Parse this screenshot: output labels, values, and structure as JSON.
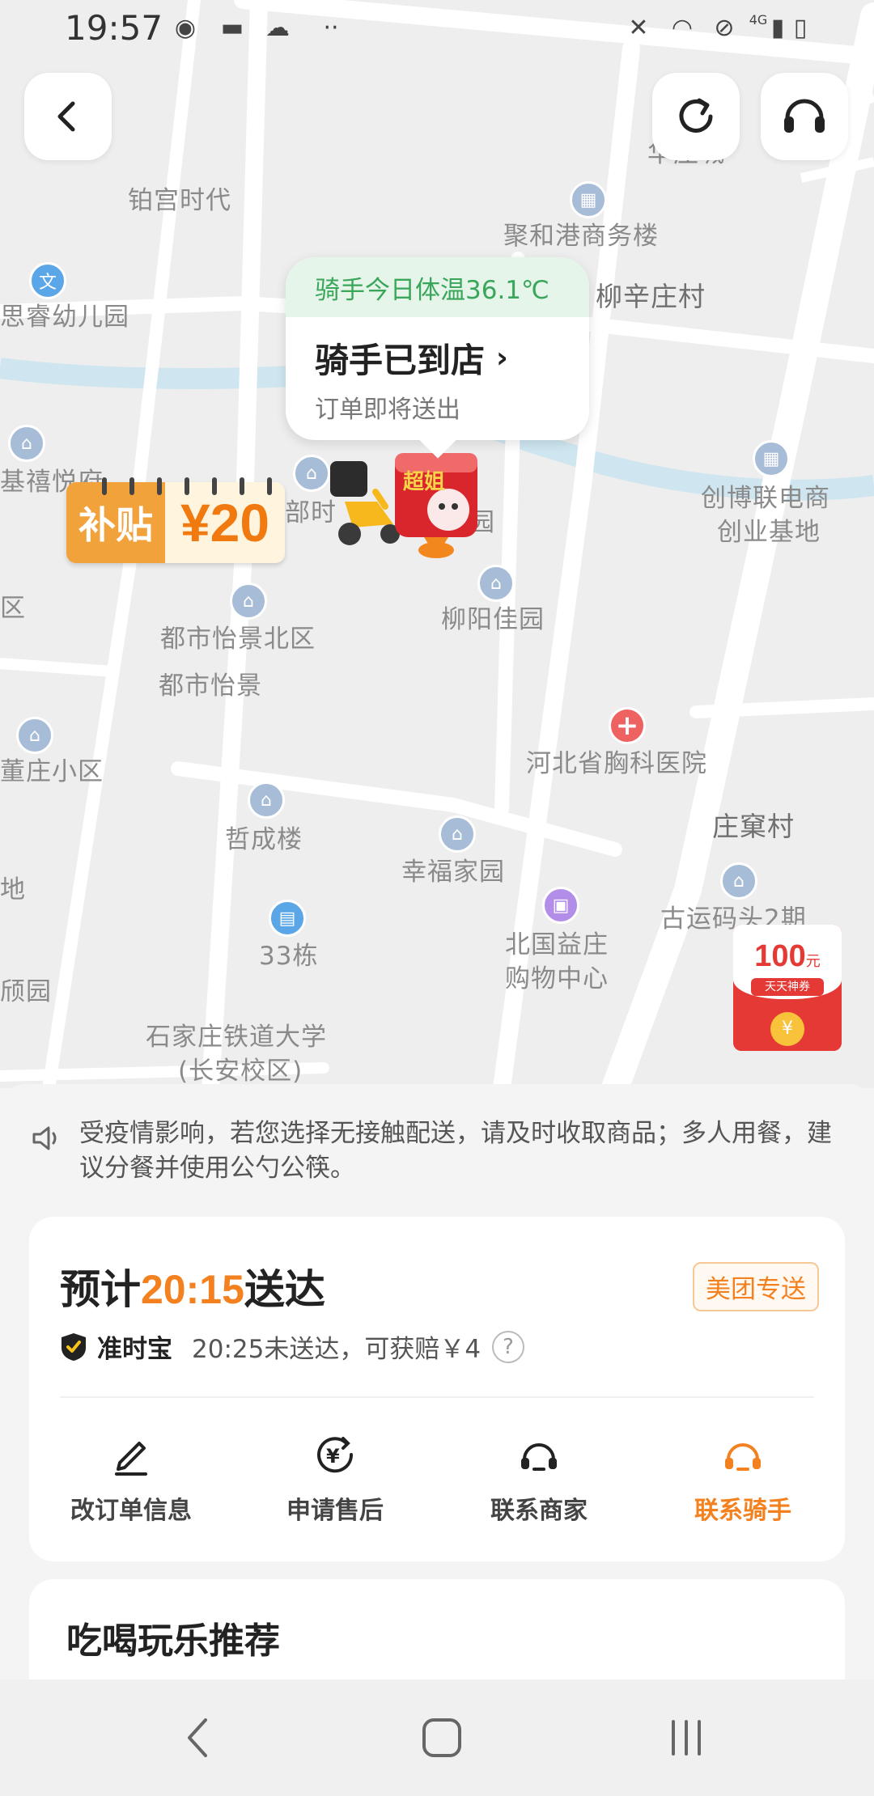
{
  "status_bar": {
    "time": "19:57",
    "network": "4G"
  },
  "map": {
    "bubble": {
      "temperature": "骑手今日体温36.1℃",
      "title": "骑手已到店",
      "subtitle": "订单即将送出"
    },
    "subsidy": {
      "label": "补贴",
      "amount": "¥20"
    },
    "shop_sign": "超姐",
    "red_packet": {
      "amount": "100",
      "unit": "元",
      "tag": "天天神券",
      "coin": "¥"
    },
    "pois": [
      {
        "name": "铂宫时代"
      },
      {
        "name": "聚和港商务楼"
      },
      {
        "name": "柳辛庄村"
      },
      {
        "name": "思睿幼儿园"
      },
      {
        "name": "基禧悦府"
      },
      {
        "name": "部时"
      },
      {
        "name": "园"
      },
      {
        "name": "创博联电商"
      },
      {
        "name": "创业基地"
      },
      {
        "name": "柳阳佳园"
      },
      {
        "name": "都市怡景北区"
      },
      {
        "name": "都市怡景"
      },
      {
        "name": "区"
      },
      {
        "name": "董庄小区"
      },
      {
        "name": "河北省胸科医院"
      },
      {
        "name": "庄窠村"
      },
      {
        "name": "哲成楼"
      },
      {
        "name": "幸福家园"
      },
      {
        "name": "地"
      },
      {
        "name": "古运码头2期"
      },
      {
        "name": "北国益庄"
      },
      {
        "name": "购物中心"
      },
      {
        "name": "33栋"
      },
      {
        "name": "颀园"
      },
      {
        "name": "石家庄铁道大学"
      },
      {
        "name": "(长安校区)"
      },
      {
        "name": "华庄城"
      }
    ]
  },
  "sheet": {
    "notice": "受疫情影响，若您选择无接触配送，请及时收取商品；多人用餐，建议分餐并使用公勺公筷。",
    "eta": {
      "prefix": "预计",
      "time": "20:15",
      "suffix": "送达",
      "tag": "美团专送"
    },
    "ontime": {
      "name": "准时宝",
      "desc": "20:25未送达，可获赔￥4",
      "help": "?"
    },
    "actions": [
      {
        "label": "改订单信息",
        "icon": "edit-icon"
      },
      {
        "label": "申请售后",
        "icon": "after-sale-icon"
      },
      {
        "label": "联系商家",
        "icon": "merchant-headset-icon"
      },
      {
        "label": "联系骑手",
        "icon": "rider-headset-icon"
      }
    ],
    "recommend_title": "吃喝玩乐推荐"
  },
  "colors": {
    "accent": "#f4811f",
    "green": "#3aa65a",
    "red": "#e53935"
  }
}
